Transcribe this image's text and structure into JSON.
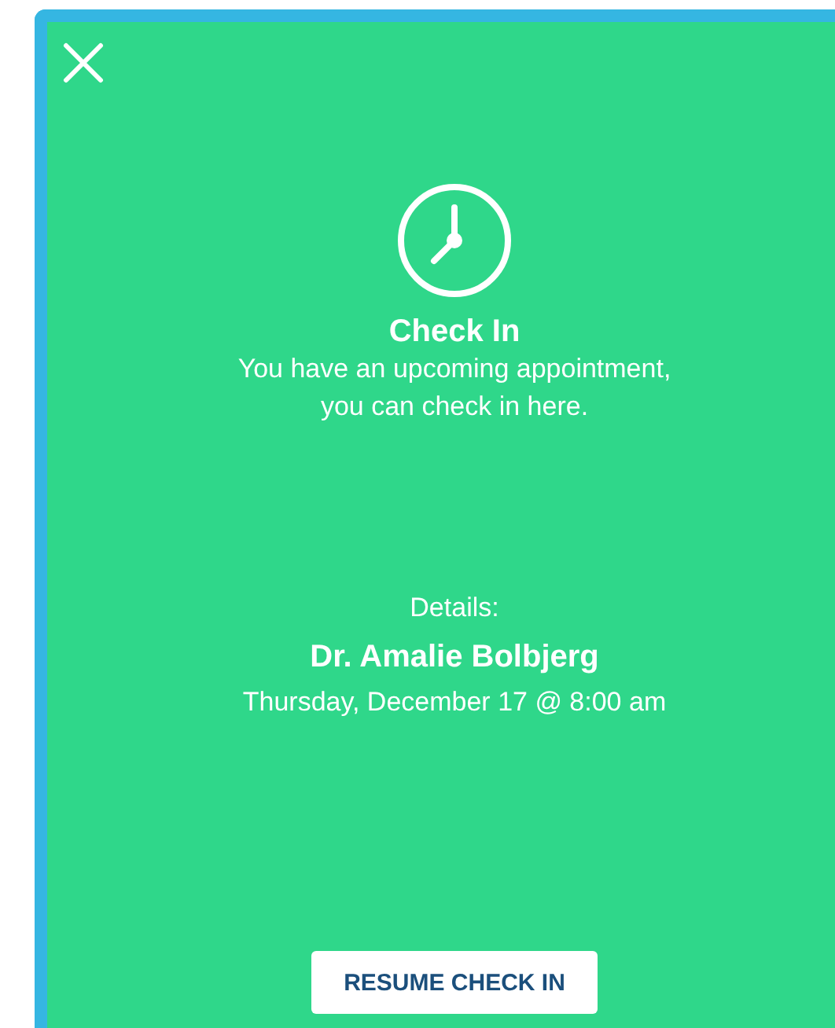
{
  "title": "Check In",
  "message": "You have an upcoming appointment,\nyou can check in here.",
  "details": {
    "label": "Details:",
    "doctor": "Dr. Amalie Bolbjerg",
    "datetime": "Thursday, December 17 @ 8:00 am"
  },
  "buttons": [
    {
      "label": "RESUME CHECK IN"
    }
  ]
}
